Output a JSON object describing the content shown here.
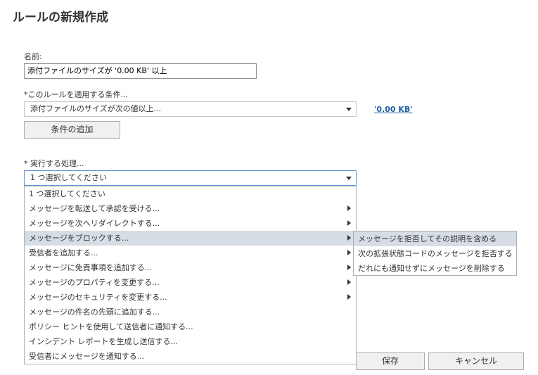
{
  "page": {
    "title": "ルールの新規作成"
  },
  "name_field": {
    "label": "名前:",
    "value": "添付ファイルのサイズが '0.00 KB' 以上"
  },
  "condition": {
    "label": "*このルールを適用する条件...",
    "selected": "添付ファイルのサイズが次の値以上...",
    "value_link": "'0.00 KB'",
    "add_button": "条件の追加"
  },
  "action": {
    "label": "* 実行する処理...",
    "selected": "1 つ選択してください"
  },
  "dropdown": {
    "items": [
      {
        "label": "1 つ選択してください",
        "has_submenu": false
      },
      {
        "label": "メッセージを転送して承認を受ける...",
        "has_submenu": true
      },
      {
        "label": "メッセージを次へリダイレクトする...",
        "has_submenu": true
      },
      {
        "label": "メッセージをブロックする...",
        "has_submenu": true,
        "highlighted": true
      },
      {
        "label": "受信者を追加する...",
        "has_submenu": true
      },
      {
        "label": "メッセージに免責事項を追加する...",
        "has_submenu": true
      },
      {
        "label": "メッセージのプロパティを変更する...",
        "has_submenu": true
      },
      {
        "label": "メッセージのセキュリティを変更する...",
        "has_submenu": true
      },
      {
        "label": "メッセージの件名の先頭に追加する...",
        "has_submenu": false
      },
      {
        "label": "ポリシー ヒントを使用して送信者に通知する...",
        "has_submenu": false
      },
      {
        "label": "インシデント レポートを生成し送信する...",
        "has_submenu": false
      },
      {
        "label": "受信者にメッセージを通知する...",
        "has_submenu": false
      }
    ]
  },
  "submenu": {
    "items": [
      {
        "label": "メッセージを拒否してその説明を含める",
        "highlighted": true
      },
      {
        "label": "次の拡張状態コードのメッセージを拒否する"
      },
      {
        "label": "だれにも通知せずにメッセージを削除する"
      }
    ]
  },
  "footer": {
    "save": "保存",
    "cancel": "キャンセル"
  },
  "colors": {
    "highlight": "#d6dde5",
    "link": "#1f5fa6",
    "focus_border": "#5b9bd5"
  }
}
